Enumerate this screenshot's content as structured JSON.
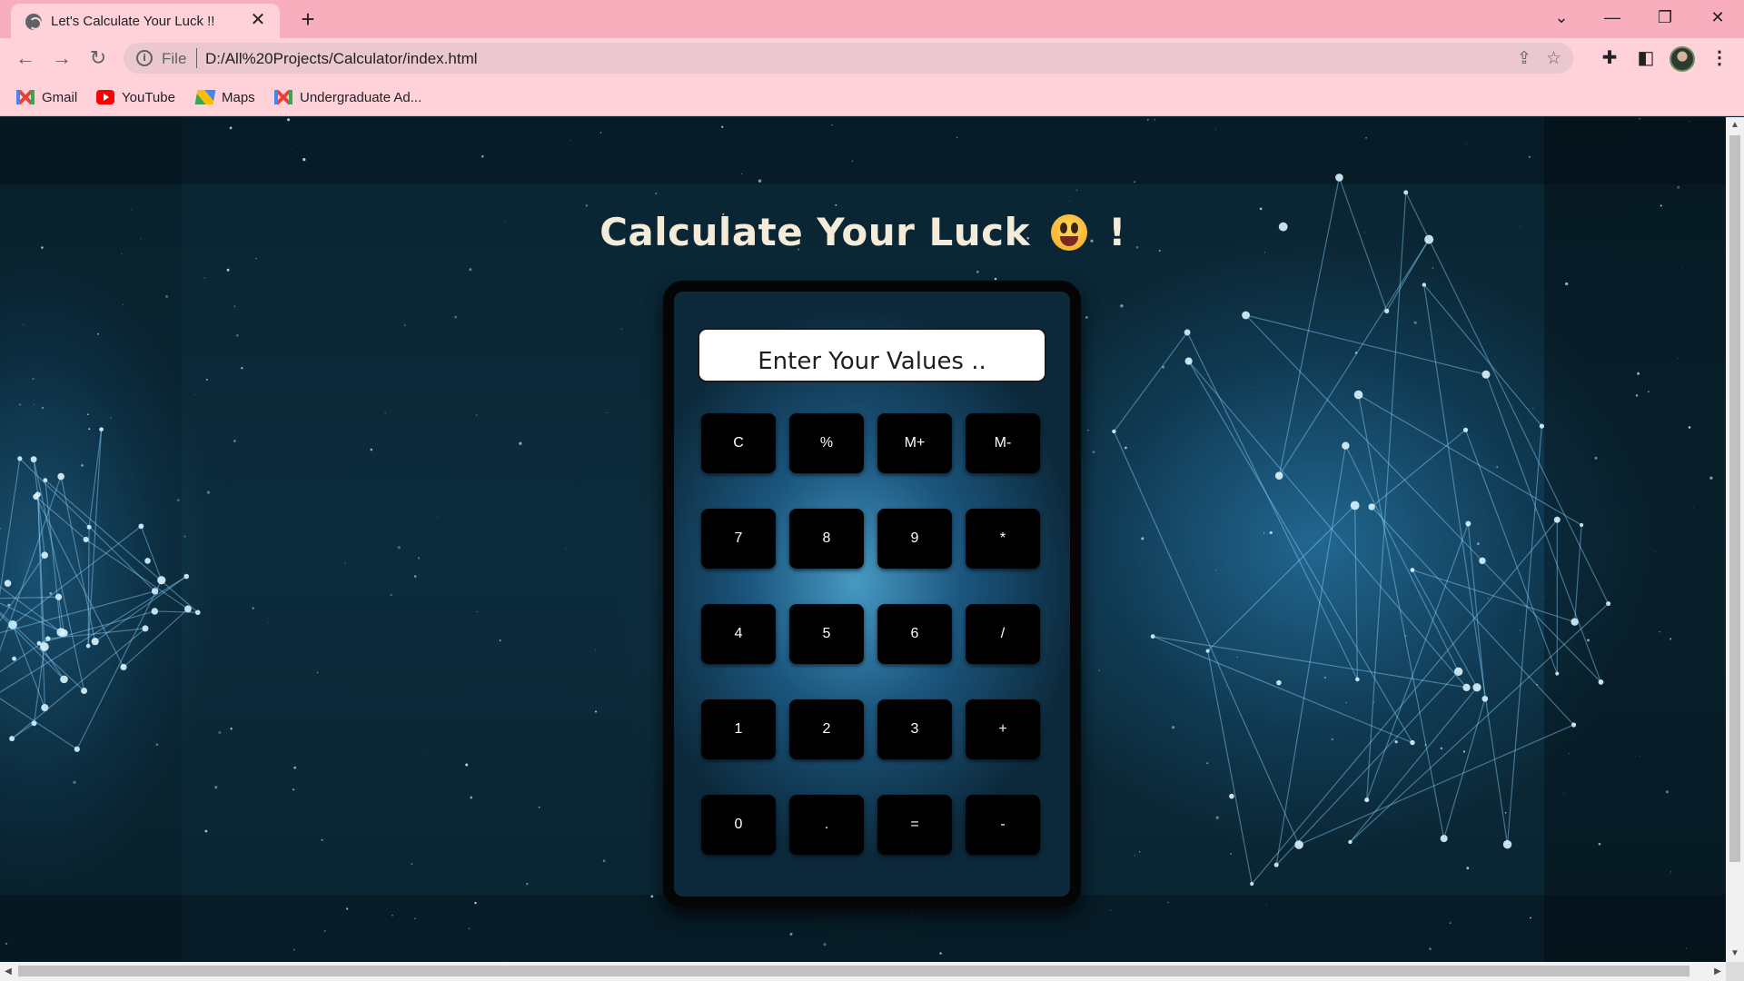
{
  "browser": {
    "tab": {
      "title": "Let's Calculate Your Luck !!"
    },
    "address": {
      "scheme": "File",
      "url": "D:/All%20Projects/Calculator/index.html"
    },
    "bookmarks": [
      {
        "label": "Gmail",
        "icon": "gmail-icon"
      },
      {
        "label": "YouTube",
        "icon": "youtube-icon"
      },
      {
        "label": "Maps",
        "icon": "maps-icon"
      },
      {
        "label": "Undergraduate Ad...",
        "icon": "gmail-icon"
      }
    ]
  },
  "page": {
    "title": "Calculate Your Luck",
    "title_suffix": "!",
    "title_emoji": "grinning-face-emoji"
  },
  "calculator": {
    "display": {
      "placeholder": "Enter Your Values ..",
      "value": ""
    },
    "keys": [
      [
        "C",
        "%",
        "M+",
        "M-"
      ],
      [
        "7",
        "8",
        "9",
        "*"
      ],
      [
        "4",
        "5",
        "6",
        "/"
      ],
      [
        "1",
        "2",
        "3",
        "+"
      ],
      [
        "0",
        ".",
        "=",
        "-"
      ]
    ]
  },
  "colors": {
    "tabstrip": "#f8aebd",
    "toolbar": "#ffd2da",
    "title_text": "#f4ecd8",
    "key_bg": "#000000",
    "key_text": "#ffffff"
  }
}
